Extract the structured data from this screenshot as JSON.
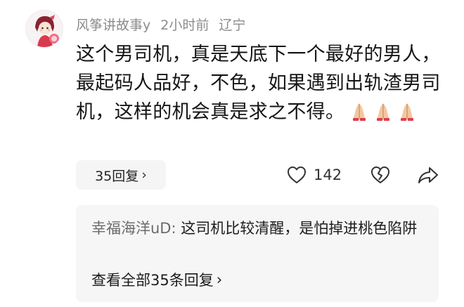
{
  "comment": {
    "username": "风筝讲故事y",
    "time": "2小时前",
    "location": "辽宁",
    "text": "这个男司机，真是天底下一个最好的男人，最起码人品好，不色，如果遇到出轨渣男司机，这样的机会真是求之不得。",
    "emojis": [
      "🙏",
      "🙏",
      "🙏"
    ]
  },
  "actions": {
    "replies_label": "35回复",
    "replies_chevron": "›",
    "like_count": "142",
    "like_icon": "heart-outline-icon",
    "dislike_icon": "broken-heart-icon",
    "share_icon": "share-arrow-icon"
  },
  "reply_preview": {
    "username": "幸福海洋uD",
    "separator": ": ",
    "text": "这司机比较清醒，是怕掉进桃色陷阱",
    "view_all": "查看全部35条回复",
    "view_all_chevron": "›"
  },
  "colors": {
    "meta_text": "#8c8c8c",
    "chip_bg": "#f5f5f5",
    "reply_bg": "#f6f6f6"
  }
}
